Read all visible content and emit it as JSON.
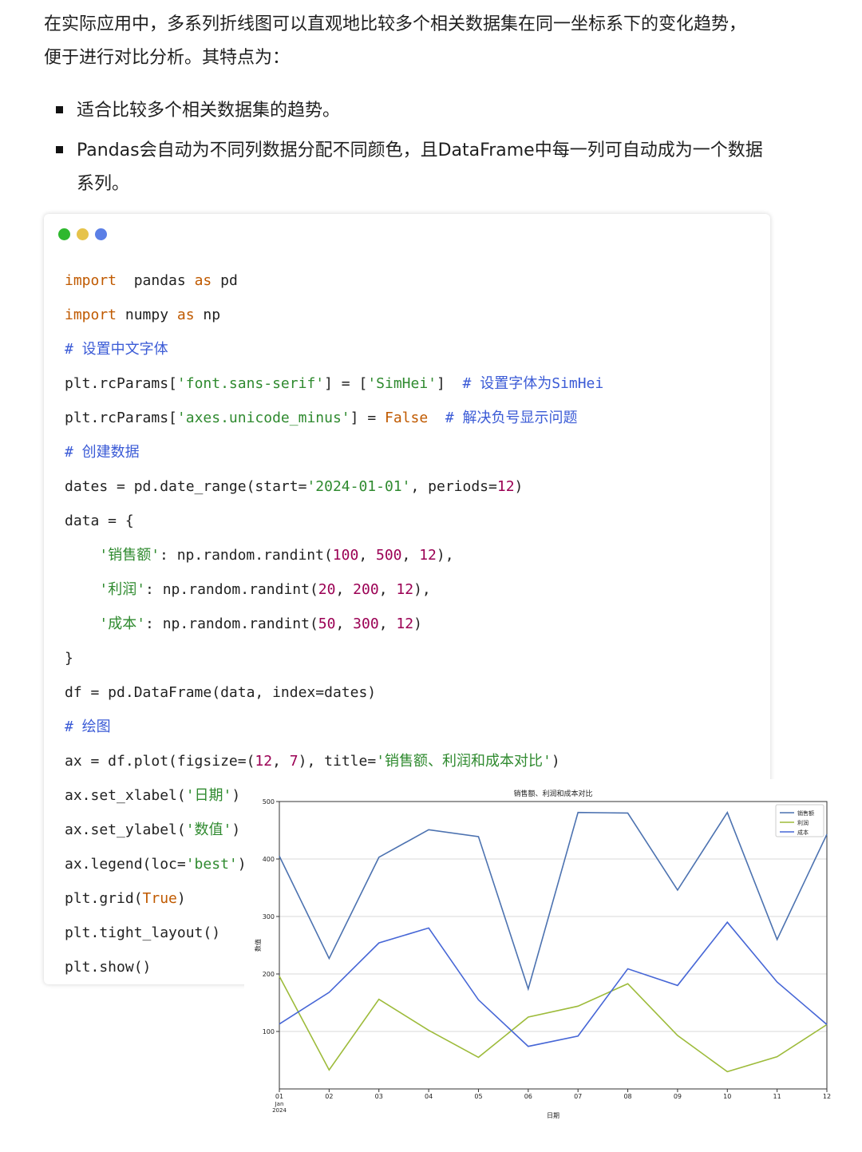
{
  "article": {
    "intro": "在实际应用中，多系列折线图可以直观地比较多个相关数据集在同一坐标系下的变化趋势，便于进行对比分析。其特点为：",
    "bullets": [
      "适合比较多个相关数据集的趋势。",
      "Pandas会自动为不同列数据分配不同颜色，且DataFrame中每一列可自动成为一个数据系列。"
    ]
  },
  "code": {
    "lines": [
      [
        [
          "kw",
          "import"
        ],
        [
          "",
          "  pandas "
        ],
        [
          "kw",
          "as"
        ],
        [
          "",
          " pd"
        ]
      ],
      [
        [
          "kw",
          "import"
        ],
        [
          "",
          "",
          " numpy "
        ],
        [
          "kw",
          "as"
        ],
        [
          "",
          " np"
        ]
      ],
      [
        [
          "cmt",
          "# 设置中文字体"
        ]
      ],
      [
        [
          "",
          "plt.rcParams["
        ],
        [
          "str",
          "'font.sans-serif'"
        ],
        [
          "",
          "] = ["
        ],
        [
          "str",
          "'SimHei'"
        ],
        [
          "",
          "]  "
        ],
        [
          "cmt",
          "# 设置字体为SimHei"
        ]
      ],
      [
        [
          "",
          "plt.rcParams["
        ],
        [
          "str",
          "'axes.unicode_minus'"
        ],
        [
          "",
          "] = "
        ],
        [
          "kw",
          "False"
        ],
        [
          "",
          "  "
        ],
        [
          "cmt",
          "# 解决负号显示问题"
        ]
      ],
      [
        [
          "cmt",
          "# 创建数据"
        ]
      ],
      [
        [
          "",
          "dates = pd.date_range(start="
        ],
        [
          "str",
          "'2024-01-01'"
        ],
        [
          "",
          ", periods="
        ],
        [
          "num",
          "12"
        ],
        [
          "",
          ")"
        ]
      ],
      [
        [
          "",
          "data = {"
        ]
      ],
      [
        [
          "",
          "    "
        ],
        [
          "str",
          "'销售额'"
        ],
        [
          "",
          ": np.random.randint("
        ],
        [
          "num",
          "100"
        ],
        [
          "",
          ", "
        ],
        [
          "num",
          "500"
        ],
        [
          "",
          ", "
        ],
        [
          "num",
          "12"
        ],
        [
          "",
          "),"
        ]
      ],
      [
        [
          "",
          "    "
        ],
        [
          "str",
          "'利润'"
        ],
        [
          "",
          ": np.random.randint("
        ],
        [
          "num",
          "20"
        ],
        [
          "",
          ", "
        ],
        [
          "num",
          "200"
        ],
        [
          "",
          ", "
        ],
        [
          "num",
          "12"
        ],
        [
          "",
          "),"
        ]
      ],
      [
        [
          "",
          "    "
        ],
        [
          "str",
          "'成本'"
        ],
        [
          "",
          ": np.random.randint("
        ],
        [
          "num",
          "50"
        ],
        [
          "",
          ", "
        ],
        [
          "num",
          "300"
        ],
        [
          "",
          ", "
        ],
        [
          "num",
          "12"
        ],
        [
          "",
          ")"
        ]
      ],
      [
        [
          "",
          "}"
        ]
      ],
      [
        [
          "",
          "df = pd.DataFrame(data, index=dates)"
        ]
      ],
      [
        [
          "cmt",
          "# 绘图"
        ]
      ],
      [
        [
          "",
          "ax = df.plot(figsize=("
        ],
        [
          "num",
          "12"
        ],
        [
          "",
          ", "
        ],
        [
          "num",
          "7"
        ],
        [
          "",
          "), title="
        ],
        [
          "str",
          "'销售额、利润和成本对比'"
        ],
        [
          "",
          ")"
        ]
      ],
      [
        [
          "",
          "ax.set_xlabel("
        ],
        [
          "str",
          "'日期'"
        ],
        [
          "",
          ")"
        ]
      ],
      [
        [
          "",
          "ax.set_ylabel("
        ],
        [
          "str",
          "'数值'"
        ],
        [
          "",
          ")"
        ]
      ],
      [
        [
          "",
          "ax.legend(loc="
        ],
        [
          "str",
          "'best'"
        ],
        [
          "",
          ")"
        ]
      ],
      [
        [
          "",
          "plt.grid("
        ],
        [
          "kw",
          "True"
        ],
        [
          "",
          ")"
        ]
      ],
      [
        [
          "",
          "plt.tight_layout()"
        ]
      ],
      [
        [
          "",
          "plt.show()"
        ]
      ]
    ]
  },
  "chart_data": {
    "type": "line",
    "title": "销售额、利润和成本对比",
    "xlabel": "日期",
    "ylabel": "数值",
    "x": [
      "01",
      "02",
      "03",
      "04",
      "05",
      "06",
      "07",
      "08",
      "09",
      "10",
      "11",
      "12"
    ],
    "x_sublabel": [
      "Jan",
      "2024"
    ],
    "ylim": [
      0,
      500
    ],
    "yticks": [
      100,
      200,
      300,
      400,
      500
    ],
    "grid": "horizontal",
    "legend_position": "top-right",
    "series": [
      {
        "name": "销售额",
        "color": "#4c72b0",
        "values": [
          405,
          227,
          403,
          451,
          439,
          174,
          481,
          480,
          346,
          481,
          260,
          443
        ]
      },
      {
        "name": "利润",
        "color": "#9dbb3a",
        "values": [
          196,
          33,
          156,
          102,
          55,
          125,
          144,
          183,
          93,
          30,
          56,
          112
        ]
      },
      {
        "name": "成本",
        "color": "#4666d6",
        "values": [
          113,
          168,
          254,
          280,
          155,
          74,
          92,
          209,
          180,
          290,
          186,
          112
        ]
      }
    ]
  }
}
